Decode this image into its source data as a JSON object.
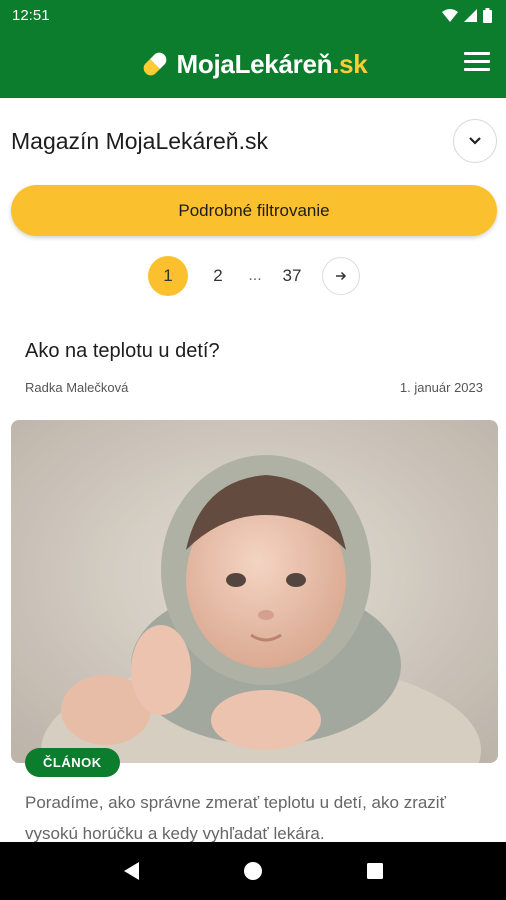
{
  "status_bar": {
    "time": "12:51"
  },
  "app_bar": {
    "logo_name": "MojaLekáreň",
    "logo_tld": ".sk",
    "menu_icon": "hamburger-menu-icon"
  },
  "header": {
    "title": "Magazín MojaLekáreň.sk",
    "collapse_icon": "chevron-down-icon"
  },
  "filter": {
    "label": "Podrobné filtrovanie"
  },
  "pagination": {
    "pages": [
      "1",
      "2"
    ],
    "ellipsis": "...",
    "last": "37",
    "active": "1",
    "next_icon": "arrow-right-icon"
  },
  "article": {
    "title": "Ako na teplotu u detí?",
    "author": "Radka Malečková",
    "date": "1. január 2023",
    "image": "baby-in-knit-hood-photo",
    "badge": "ČLÁNOK",
    "excerpt": "Poradíme, ako správne zmerať teplotu u detí, ako zraziť vysokú horúčku a kedy vyhľadať lekára."
  },
  "nav": {
    "back_icon": "back-icon",
    "home_icon": "home-icon",
    "recents_icon": "recents-icon"
  },
  "colors": {
    "brand_green": "#0b7d2d",
    "accent_yellow": "#fbc02d"
  }
}
